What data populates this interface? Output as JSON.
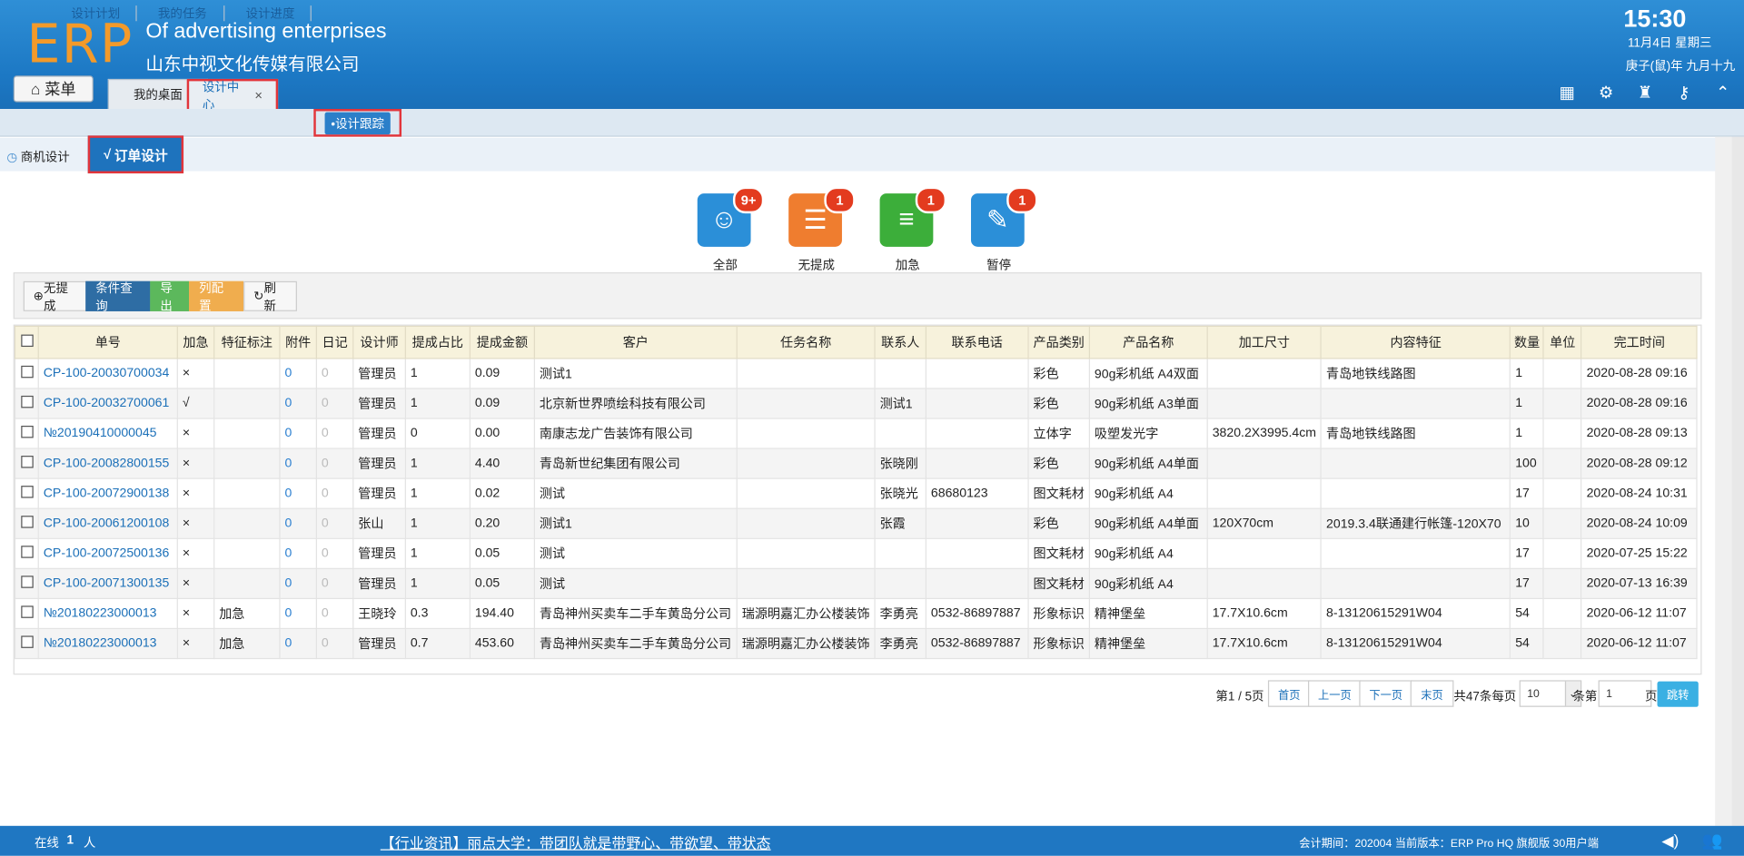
{
  "header": {
    "logo": "ERP",
    "app_title": "Of advertising enterprises",
    "company": "山东中视文化传媒有限公司",
    "clock": "15:30",
    "date": "11月4日 星期三",
    "lunar": "庚子(鼠)年 九月十九",
    "menu_label": "菜单",
    "tabs": [
      {
        "label": "我的桌面"
      },
      {
        "label": "设计中心",
        "close": "×"
      }
    ]
  },
  "subnav": {
    "items": [
      "设计计划",
      "我的任务",
      "设计进度"
    ],
    "active": "•设计跟踪"
  },
  "sectabs": {
    "business": "商机设计",
    "order": "订单设计",
    "order_check": "√"
  },
  "categories": [
    {
      "label": "全部",
      "badge": "9+",
      "color": "#2b8fd8"
    },
    {
      "label": "无提成",
      "badge": "1",
      "color": "#ef7d2f"
    },
    {
      "label": "加急",
      "badge": "1",
      "color": "#3cae3a"
    },
    {
      "label": "暂停",
      "badge": "1",
      "color": "#2b8fd8"
    }
  ],
  "toolbar": {
    "no_commission": "无提成",
    "query": "条件查询",
    "export": "导出",
    "columns": "列配置",
    "refresh": "刷新"
  },
  "table": {
    "headers": [
      "单号",
      "加急",
      "特征标注",
      "附件",
      "日记",
      "设计师",
      "提成占比",
      "提成金额",
      "客户",
      "任务名称",
      "联系人",
      "联系电话",
      "产品类别",
      "产品名称",
      "加工尺寸",
      "内容特征",
      "数量",
      "单位",
      "完工时间"
    ],
    "rows": [
      [
        "CP-100-20030700034",
        "×",
        "",
        "0",
        "0",
        "管理员",
        "1",
        "0.09",
        "测试1",
        "",
        "",
        "",
        "彩色",
        "90g彩机纸 A4双面",
        "",
        "青岛地铁线路图",
        "1",
        "",
        "2020-08-28 09:16"
      ],
      [
        "CP-100-20032700061",
        "√",
        "",
        "0",
        "0",
        "管理员",
        "1",
        "0.09",
        "北京新世界喷绘科技有限公司",
        "",
        "测试1",
        "",
        "彩色",
        "90g彩机纸 A3单面",
        "",
        "",
        "1",
        "",
        "2020-08-28 09:16"
      ],
      [
        "№20190410000045",
        "×",
        "",
        "0",
        "0",
        "管理员",
        "0",
        "0.00",
        "南康志龙广告装饰有限公司",
        "",
        "",
        "",
        "立体字",
        "吸塑发光字",
        "3820.2X3995.4cm",
        "青岛地铁线路图",
        "1",
        "",
        "2020-08-28 09:13"
      ],
      [
        "CP-100-20082800155",
        "×",
        "",
        "0",
        "0",
        "管理员",
        "1",
        "4.40",
        "青岛新世纪集团有限公司",
        "",
        "张晓刚",
        "",
        "彩色",
        "90g彩机纸 A4单面",
        "",
        "",
        "100",
        "",
        "2020-08-28 09:12"
      ],
      [
        "CP-100-20072900138",
        "×",
        "",
        "0",
        "0",
        "管理员",
        "1",
        "0.02",
        "测试",
        "",
        "张晓光",
        "68680123",
        "图文耗材",
        "90g彩机纸 A4",
        "",
        "",
        "17",
        "",
        "2020-08-24 10:31"
      ],
      [
        "CP-100-20061200108",
        "×",
        "",
        "0",
        "0",
        "张山",
        "1",
        "0.20",
        "测试1",
        "",
        "张霞",
        "",
        "彩色",
        "90g彩机纸 A4单面",
        "120X70cm",
        "2019.3.4联通建行帐篷-120X70",
        "10",
        "",
        "2020-08-24 10:09"
      ],
      [
        "CP-100-20072500136",
        "×",
        "",
        "0",
        "0",
        "管理员",
        "1",
        "0.05",
        "测试",
        "",
        "",
        "",
        "图文耗材",
        "90g彩机纸 A4",
        "",
        "",
        "17",
        "",
        "2020-07-25 15:22"
      ],
      [
        "CP-100-20071300135",
        "×",
        "",
        "0",
        "0",
        "管理员",
        "1",
        "0.05",
        "测试",
        "",
        "",
        "",
        "图文耗材",
        "90g彩机纸 A4",
        "",
        "",
        "17",
        "",
        "2020-07-13 16:39"
      ],
      [
        "№20180223000013",
        "×",
        "加急",
        "0",
        "0",
        "王晓玲",
        "0.3",
        "194.40",
        "青岛神州买卖车二手车黄岛分公司",
        "瑞源明嘉汇办公楼装饰",
        "李勇亮",
        "0532-86897887",
        "形象标识",
        "精神堡垒",
        "17.7X10.6cm",
        "8-13120615291W04",
        "54",
        "",
        "2020-06-12 11:07"
      ],
      [
        "№20180223000013",
        "×",
        "加急",
        "0",
        "0",
        "管理员",
        "0.7",
        "453.60",
        "青岛神州买卖车二手车黄岛分公司",
        "瑞源明嘉汇办公楼装饰",
        "李勇亮",
        "0532-86897887",
        "形象标识",
        "精神堡垒",
        "17.7X10.6cm",
        "8-13120615291W04",
        "54",
        "",
        "2020-06-12 11:07"
      ]
    ]
  },
  "pager": {
    "page_info": "第1 / 5页",
    "first": "首页",
    "prev": "上一页",
    "next": "下一页",
    "last": "末页",
    "total_label": "共47条每页",
    "per_page": "10",
    "per_page_suffix": "条第",
    "page_input": "1",
    "page_suffix": "页",
    "jump": "跳转"
  },
  "footer": {
    "online_label": "在线",
    "online_count": "1",
    "online_unit": "人",
    "news": "【行业资讯】丽点大学：带团队就是带野心、带欲望、带状态",
    "version": "会计期间：202004 当前版本：ERP Pro HQ 旗舰版 30用户端"
  }
}
